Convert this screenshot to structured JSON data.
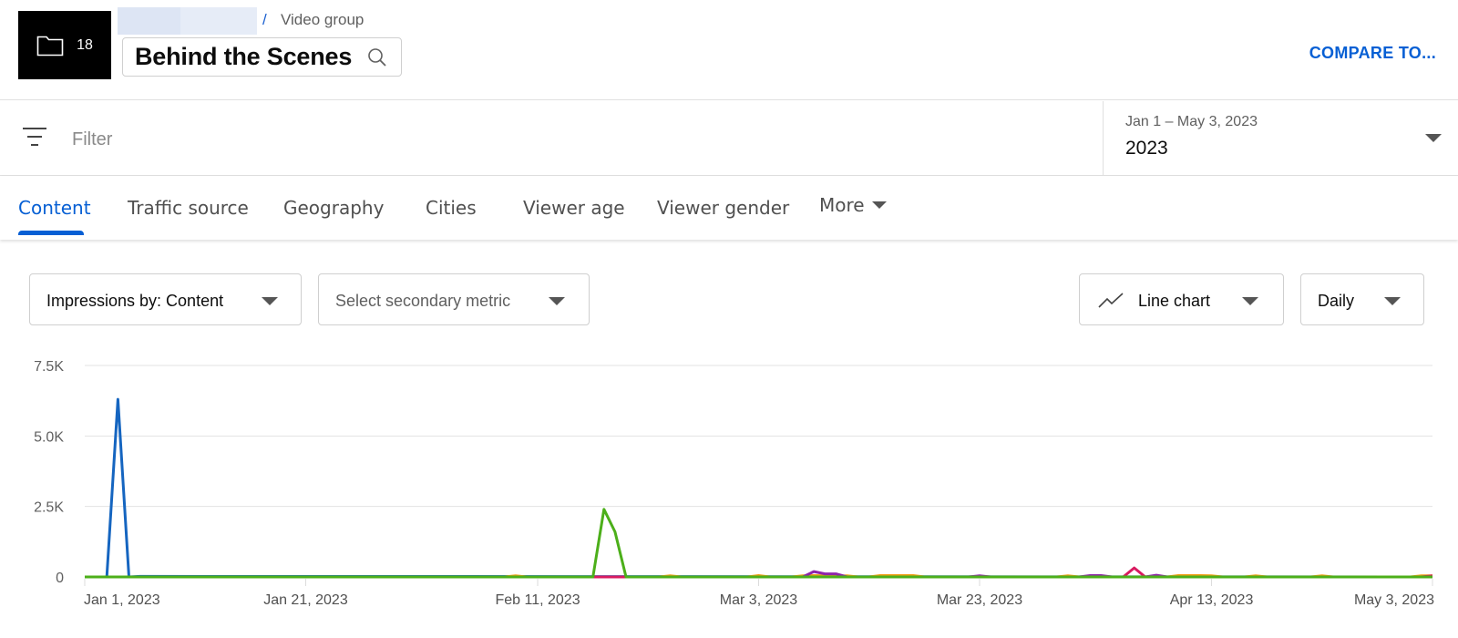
{
  "header": {
    "group_item_count": "18",
    "folder_icon": "folder-icon",
    "breadcrumb_separator": "/",
    "breadcrumb_label": "Video group",
    "title": "Behind the Scenes",
    "search_icon": "search-icon",
    "compare_label": "COMPARE TO..."
  },
  "filterbar": {
    "filter_icon": "filter-icon",
    "filter_placeholder": "Filter",
    "date_range": "Jan 1 – May 3, 2023",
    "date_preset": "2023"
  },
  "tabs": [
    {
      "label": "Content",
      "active": true
    },
    {
      "label": "Traffic source",
      "active": false
    },
    {
      "label": "Geography",
      "active": false
    },
    {
      "label": "Cities",
      "active": false
    },
    {
      "label": "Viewer age",
      "active": false
    },
    {
      "label": "Viewer gender",
      "active": false
    },
    {
      "label": "More",
      "active": false
    }
  ],
  "controls": {
    "primary_metric": "Impressions by: Content",
    "secondary_metric_placeholder": "Select secondary metric",
    "chart_type": "Line chart",
    "interval": "Daily"
  },
  "colors": {
    "accent": "#065fd4",
    "series_blue": "#1565c0",
    "series_green": "#4caf1a",
    "series_orange": "#f39c12",
    "series_purple": "#8e24aa",
    "series_pink": "#d81b60"
  },
  "chart_data": {
    "type": "line",
    "title": "",
    "xlabel": "",
    "ylabel": "",
    "x_start": "2023-01-01",
    "x_end": "2023-05-03",
    "x_tick_labels": [
      {
        "label": "Jan 1, 2023",
        "day": 0
      },
      {
        "label": "Jan 21, 2023",
        "day": 20
      },
      {
        "label": "Feb 11, 2023",
        "day": 41
      },
      {
        "label": "Mar 3, 2023",
        "day": 61
      },
      {
        "label": "Mar 23, 2023",
        "day": 81
      },
      {
        "label": "Apr 13, 2023",
        "day": 102
      },
      {
        "label": "May 3, 2023",
        "day": 122
      }
    ],
    "y_tick_labels": [
      {
        "label": "0",
        "value": 0
      },
      {
        "label": "2.5K",
        "value": 2500
      },
      {
        "label": "5.0K",
        "value": 5000
      },
      {
        "label": "7.5K",
        "value": 7500
      }
    ],
    "ylim": [
      0,
      7500
    ],
    "grid": true,
    "legend": "none",
    "series": [
      {
        "name": "Video (blue)",
        "color": "#1565c0",
        "points": [
          [
            0,
            0
          ],
          [
            2,
            0
          ],
          [
            3,
            6300
          ],
          [
            4,
            0
          ],
          [
            5,
            20
          ],
          [
            122,
            0
          ]
        ]
      },
      {
        "name": "Video (orange)",
        "color": "#f39c12",
        "points": [
          [
            0,
            0
          ],
          [
            38,
            0
          ],
          [
            39,
            40
          ],
          [
            40,
            0
          ],
          [
            47,
            0
          ],
          [
            48,
            0
          ],
          [
            49,
            0
          ],
          [
            50,
            0
          ],
          [
            52,
            0
          ],
          [
            53,
            40
          ],
          [
            54,
            0
          ],
          [
            60,
            0
          ],
          [
            61,
            50
          ],
          [
            62,
            0
          ],
          [
            64,
            0
          ],
          [
            65,
            40
          ],
          [
            66,
            50
          ],
          [
            67,
            40
          ],
          [
            68,
            30
          ],
          [
            69,
            40
          ],
          [
            70,
            0
          ],
          [
            71,
            0
          ],
          [
            72,
            50
          ],
          [
            73,
            50
          ],
          [
            74,
            50
          ],
          [
            75,
            50
          ],
          [
            76,
            0
          ],
          [
            88,
            0
          ],
          [
            89,
            40
          ],
          [
            90,
            0
          ],
          [
            98,
            0
          ],
          [
            99,
            50
          ],
          [
            100,
            50
          ],
          [
            101,
            50
          ],
          [
            102,
            40
          ],
          [
            103,
            0
          ],
          [
            105,
            0
          ],
          [
            106,
            40
          ],
          [
            107,
            0
          ],
          [
            111,
            0
          ],
          [
            112,
            40
          ],
          [
            113,
            0
          ],
          [
            120,
            0
          ],
          [
            121,
            40
          ],
          [
            122,
            40
          ]
        ]
      },
      {
        "name": "Video (purple)",
        "color": "#8e24aa",
        "points": [
          [
            0,
            0
          ],
          [
            65,
            0
          ],
          [
            66,
            190
          ],
          [
            67,
            110
          ],
          [
            68,
            110
          ],
          [
            69,
            0
          ],
          [
            80,
            0
          ],
          [
            81,
            40
          ],
          [
            82,
            0
          ],
          [
            90,
            0
          ],
          [
            91,
            50
          ],
          [
            92,
            50
          ],
          [
            93,
            0
          ],
          [
            96,
            0
          ],
          [
            97,
            60
          ],
          [
            98,
            0
          ],
          [
            122,
            0
          ]
        ]
      },
      {
        "name": "Video (pink)",
        "color": "#d81b60",
        "points": [
          [
            0,
            0
          ],
          [
            94,
            0
          ],
          [
            95,
            320
          ],
          [
            96,
            0
          ],
          [
            121,
            0
          ],
          [
            122,
            40
          ]
        ]
      },
      {
        "name": "Video (green)",
        "color": "#4caf1a",
        "points": [
          [
            0,
            0
          ],
          [
            46,
            0
          ],
          [
            47,
            2400
          ],
          [
            48,
            1600
          ],
          [
            49,
            0
          ],
          [
            122,
            0
          ]
        ]
      }
    ]
  }
}
